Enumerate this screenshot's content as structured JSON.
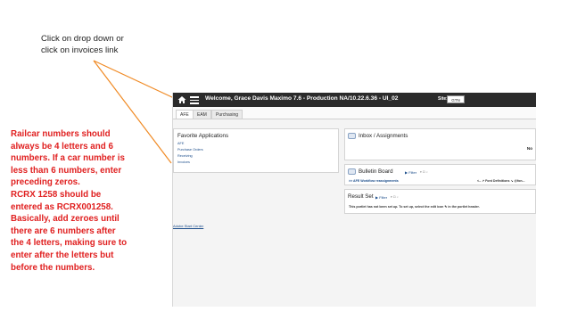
{
  "annotations": {
    "callout_lines": [
      "Click on drop down or",
      "click on invoices link"
    ],
    "note_lines": [
      "Railcar numbers should",
      "always be 4 letters and 6",
      "numbers.  If a car number is",
      "less than 6 numbers, enter",
      "preceding zeros.",
      "RCRX  1258 should be",
      "entered as RCRX001258.",
      "Basically, add zeroes until",
      "there are 6 numbers after",
      "the 4 letters, making sure to",
      "enter after the letters but",
      "before the numbers."
    ],
    "colors": {
      "note": "#e02020",
      "arrow": "#f08a24"
    }
  },
  "app": {
    "header": {
      "title": "Welcome, Grace Davis Maximo 7.6 - Production NA/10.22.6.36 - UI_02",
      "site_label": "Site:",
      "site_value": "GTN"
    },
    "tabs": [
      {
        "label": "AFE",
        "active": true
      },
      {
        "label": "EAM",
        "active": false
      },
      {
        "label": "Purchasing",
        "active": false
      }
    ],
    "favorites": {
      "title": "Favorite Applications",
      "links": [
        "AFE",
        "Purchase Orders",
        "Receiving",
        "Invoices"
      ]
    },
    "start_center_link": "Adobe Start Center",
    "inbox": {
      "title": "Inbox / Assignments",
      "cell_no": "No"
    },
    "bulletin": {
      "title": "Bulletin Board",
      "filter_label": "Filter",
      "row_left": ">> AFE Workflow reassignments",
      "row_right": "<– ↗ Font Definitions ↘ @fon..."
    },
    "result_set": {
      "title": "Result Set",
      "filter_label": "Filter",
      "message": "This portlet has not been set up. To set up, select the edit icon",
      "message_tail": "in the portlet header."
    }
  }
}
